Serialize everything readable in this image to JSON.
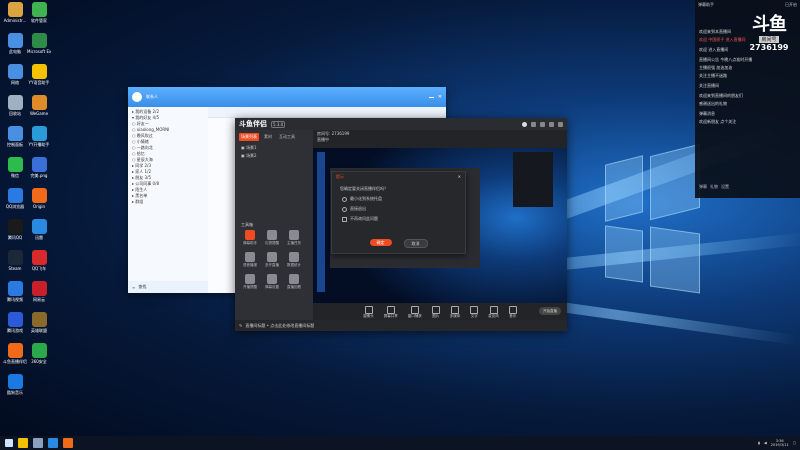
{
  "desktop": {
    "icons": [
      {
        "label": "Administr...",
        "color": "#d9a441"
      },
      {
        "label": "软件管家",
        "color": "#3fb34f"
      },
      {
        "label": "此电脑",
        "color": "#4a90e2"
      },
      {
        "label": "Microsoft Excel 2010",
        "color": "#2e8b4a"
      },
      {
        "label": "网络",
        "color": "#4a90e2"
      },
      {
        "label": "YY语音助手",
        "color": "#f2c200"
      },
      {
        "label": "回收站",
        "color": "#a0b0c0"
      },
      {
        "label": "WeGame",
        "color": "#e08b2a"
      },
      {
        "label": "控制面板",
        "color": "#4a90e2"
      },
      {
        "label": "YY开播助手",
        "color": "#2a9ad8"
      },
      {
        "label": "微信",
        "color": "#2dbb4e"
      },
      {
        "label": "完美.png",
        "color": "#3a6fd8"
      },
      {
        "label": "QQ浏览器",
        "color": "#2a7ae2"
      },
      {
        "label": "Origin",
        "color": "#f06a1a"
      },
      {
        "label": "腾讯QQ",
        "color": "#1a1a1a"
      },
      {
        "label": "迅雷",
        "color": "#2a8ae2"
      },
      {
        "label": "Steam",
        "color": "#1b2838"
      },
      {
        "label": "QQ飞车",
        "color": "#d82a2a"
      },
      {
        "label": "腾讯视频",
        "color": "#2a7ae2"
      },
      {
        "label": "网易云",
        "color": "#c8202a"
      },
      {
        "label": "腾讯游戏",
        "color": "#2a5ad8"
      },
      {
        "label": "英雄联盟",
        "color": "#8a6a2a"
      },
      {
        "label": "斗鱼直播伴侣",
        "color": "#f06a1a"
      },
      {
        "label": "360安全",
        "color": "#2aa84a"
      },
      {
        "label": "酷狗音乐",
        "color": "#1a7ae2"
      }
    ]
  },
  "right_panel": {
    "top_left": "弹幕助手",
    "top_right": "已开启",
    "logo_text": "斗鱼",
    "logo_sub": "房间号",
    "room_number": "2736199",
    "messages": [
      {
        "text": "欢迎来到本直播间",
        "red": false
      },
      {
        "text": "欢迎 中国骄子 进入直播间",
        "red": true
      },
      {
        "text": "",
        "red": false
      },
      {
        "text": "欢迎 进入直播间",
        "red": false
      },
      {
        "text": "",
        "red": false
      },
      {
        "text": "直播间公告 今晚八点准时开播",
        "red": false
      },
      {
        "text": "主播很强 加油加油",
        "red": false
      },
      {
        "text": "关注主播不迷路",
        "red": false
      },
      {
        "text": "",
        "red": false
      },
      {
        "text": "关注直播间",
        "red": false
      },
      {
        "text": "",
        "red": false
      },
      {
        "text": "欢迎来到直播间的朋友们",
        "red": false
      },
      {
        "text": "感谢送出的礼物",
        "red": false
      },
      {
        "text": "",
        "red": false
      },
      {
        "text": "弹幕消息",
        "red": false
      },
      {
        "text": "欢迎新朋友 点个关注",
        "red": false
      }
    ],
    "bottom_items": [
      "弹幕",
      "礼物",
      "设置"
    ]
  },
  "qq": {
    "title": "联系人",
    "tree": [
      "▸ 我的设备 2/2",
      "▾ 我的好友 4/5",
      "  ○ 好友一",
      "  ○ xiaolong_MORNI",
      "  ○ 晚风吹过",
      "  ○ 小情绪",
      "  ○ 一路向北",
      "  ○ 拾忆",
      "  ○ 星辰大海",
      "▸ 同学 2/3",
      "▸ 家人 1/2",
      "▸ 朋友 3/5",
      "▸ 公司同事 0/8",
      "▸ 陌生人",
      "▸ 黑名单",
      "▸ 群组"
    ],
    "right_items": [
      "",
      "",
      ""
    ],
    "bottom_label": "查找"
  },
  "douyu_app": {
    "logo": "斗鱼伴侣",
    "version": "5.3.0",
    "tabs": [
      "场景列表",
      "素材",
      "互动工具"
    ],
    "scenes": [
      "场景1",
      "场景2"
    ],
    "tools_title": "工具箱",
    "tools": [
      "弹幕助手",
      "礼物提醒",
      "主播任务",
      "语音播报",
      "多开直播",
      "数据统计",
      "开播提醒",
      "弹幕设置",
      "直播回看"
    ],
    "info_line1": "房间号: 2736199",
    "info_line2": "直播中",
    "start_btn": "开始直播",
    "actions": [
      "摄像头",
      "屏幕共享",
      "窗口捕获",
      "图片",
      "多媒体",
      "文字",
      "麦克风",
      "音乐"
    ],
    "status": "直播间标题 • 点击此处修改直播间标题"
  },
  "dialog": {
    "title": "提示",
    "message": "您确定要关闭直播伴侣吗？",
    "options": [
      "最小化到系统托盘",
      "直接退出",
      "不再询问此问题"
    ],
    "ok": "确定",
    "cancel": "取消"
  },
  "taskbar": {
    "items": [
      {
        "name": "windows-start",
        "color": "#cfe2ff"
      },
      {
        "name": "file-explorer",
        "color": "#f2c200"
      },
      {
        "name": "steam",
        "color": "#8aa0c0"
      },
      {
        "name": "qq",
        "color": "#2a8ae2"
      },
      {
        "name": "douyu",
        "color": "#f06a1a"
      }
    ],
    "time": "3:36",
    "date": "2019/3/11"
  }
}
